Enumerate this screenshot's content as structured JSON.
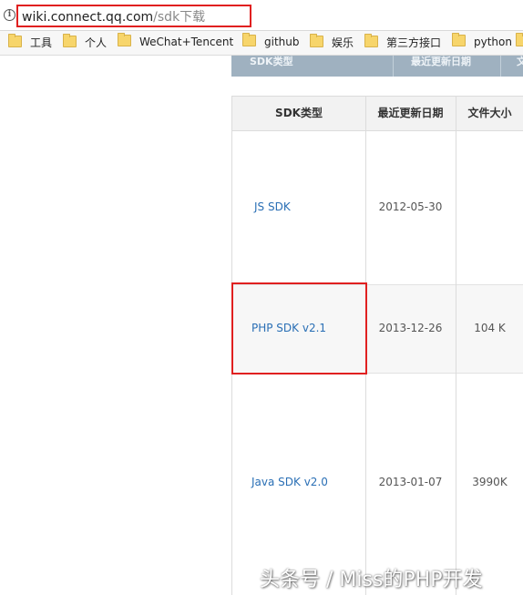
{
  "address_bar": {
    "host": "wiki.connect.qq.com",
    "path": "/sdk下载",
    "info_icon_glyph": "i"
  },
  "bookmarks": [
    "工具",
    "个人",
    "WeChat+Tencent",
    "github",
    "娱乐",
    "第三方接口",
    "python"
  ],
  "sticky_header": {
    "col1": "SDK类型",
    "col2": "最近更新日期",
    "col3": "文"
  },
  "table": {
    "headers": [
      "SDK类型",
      "最近更新日期",
      "文件大小"
    ],
    "rows": [
      {
        "name": "JS SDK",
        "date": "2012-05-30",
        "size": ""
      },
      {
        "name": "PHP SDK v2.1",
        "date": "2013-12-26",
        "size": "104 K"
      },
      {
        "name": "Java SDK v2.0",
        "date": "2013-01-07",
        "size": "3990K"
      }
    ]
  },
  "watermark": "头条号 / Miss的PHP开发",
  "colors": {
    "highlight": "#e02020",
    "link": "#2a6fb5",
    "header_bg": "#9fb1c0"
  }
}
